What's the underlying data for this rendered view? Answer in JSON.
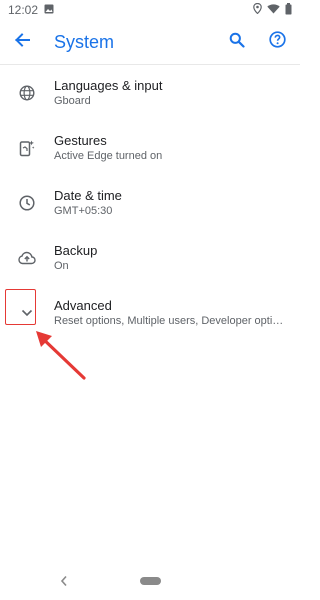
{
  "status_bar": {
    "time": "12:02"
  },
  "app_bar": {
    "title": "System"
  },
  "items": [
    {
      "title": "Languages & input",
      "subtitle": "Gboard",
      "icon": "globe-icon"
    },
    {
      "title": "Gestures",
      "subtitle": "Active Edge turned on",
      "icon": "gestures-phone-icon"
    },
    {
      "title": "Date & time",
      "subtitle": "GMT+05:30",
      "icon": "clock-icon"
    },
    {
      "title": "Backup",
      "subtitle": "On",
      "icon": "cloud-backup-icon"
    },
    {
      "title": "Advanced",
      "subtitle": "Reset options, Multiple users, Developer options",
      "icon": "chevron-down-icon"
    }
  ],
  "colors": {
    "accent": "#1a73e8",
    "annotation": "#e53935"
  }
}
